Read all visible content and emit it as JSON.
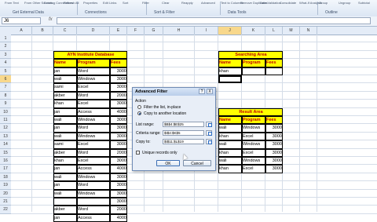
{
  "ribbon": {
    "groups": [
      "Get External Data",
      "Connections",
      "Sort & Filter",
      "Data Tools",
      "Outline"
    ],
    "small_buttons": [
      "From Text",
      "From Other Sources",
      "Existing Connections",
      "Refresh All",
      "Properties",
      "Edit Links",
      "Sort",
      "Filter",
      "Clear",
      "Reapply",
      "Advanced",
      "Text to Columns",
      "Remove Duplicates",
      "Data Validation",
      "Consolidate",
      "What-If Analysis",
      "Group",
      "Ungroup",
      "Subtotal"
    ]
  },
  "formula_bar": {
    "name_box": "J6",
    "fx": "fx",
    "value": ""
  },
  "columns": [
    "A",
    "B",
    "C",
    "D",
    "E",
    "F",
    "G",
    "H",
    "I",
    "J",
    "K",
    "L",
    "M",
    "N"
  ],
  "rows": [
    "1",
    "2",
    "3",
    "4",
    "5",
    "6",
    "7",
    "8",
    "9",
    "10",
    "11",
    "12",
    "13",
    "14",
    "15",
    "16",
    "17",
    "18",
    "19",
    "20",
    "21",
    "22"
  ],
  "database": {
    "title": "AYN Institute Database",
    "headers": [
      "Name",
      "Program",
      "Fees"
    ],
    "records": [
      [
        "jan",
        "Word",
        "3000"
      ],
      [
        "wali",
        "Windows",
        "3000"
      ],
      [
        "sami",
        "Excel",
        "3000"
      ],
      [
        "akber",
        "Word",
        "2000"
      ],
      [
        "khan",
        "Excel",
        "3000"
      ],
      [
        "jan",
        "Access",
        "4000"
      ],
      [
        "wali",
        "Windows",
        "3000"
      ],
      [
        "jan",
        "Word",
        "3000"
      ],
      [
        "wali",
        "Windows",
        "3000"
      ],
      [
        "sami",
        "Excel",
        "3000"
      ],
      [
        "akber",
        "Word",
        "2000"
      ],
      [
        "khan",
        "Excel",
        "3000"
      ],
      [
        "jan",
        "Access",
        "4000"
      ],
      [
        "wali",
        "Windows",
        "3000"
      ],
      [
        "jan",
        "Word",
        "3000"
      ],
      [
        "wali",
        "Windows",
        "3000"
      ],
      [
        "",
        "",
        "3000"
      ],
      [
        "akber",
        "Word",
        "2000"
      ],
      [
        "jan",
        "Access",
        "4000"
      ]
    ]
  },
  "search_area": {
    "title": "Searching Area",
    "headers": [
      "Name",
      "Program",
      "Fees"
    ],
    "criteria": [
      "khan",
      "",
      ""
    ]
  },
  "result_area": {
    "title": "Result Area",
    "headers": [
      "Name",
      "Program",
      "Fees"
    ],
    "records": [
      [
        "wali",
        "Windows",
        "3000"
      ],
      [
        "khan",
        "Excel",
        "3000"
      ],
      [
        "wali",
        "Windows",
        "3000"
      ],
      [
        "khan",
        "Excel",
        "3000"
      ],
      [
        "wali",
        "Windows",
        "3000"
      ],
      [
        "khan",
        "Excel",
        "3000"
      ]
    ]
  },
  "dialog": {
    "title": "Advanced Filter",
    "help": "?",
    "close": "X",
    "action_label": "Action",
    "option_in_place": "Filter the list, in-place",
    "option_copy": "Copy to another location",
    "selected_option": "copy",
    "list_range_label": "List range:",
    "list_range_value": "$B$4:$E$25",
    "criteria_range_label": "Criteria range:",
    "criteria_range_value": "$I$4:$K$5",
    "copy_to_label": "Copy to:",
    "copy_to_value": "$I$11:$L$19",
    "unique_label": "Unique records only",
    "unique_checked": false,
    "ok_label": "OK",
    "cancel_label": "Cancel"
  }
}
